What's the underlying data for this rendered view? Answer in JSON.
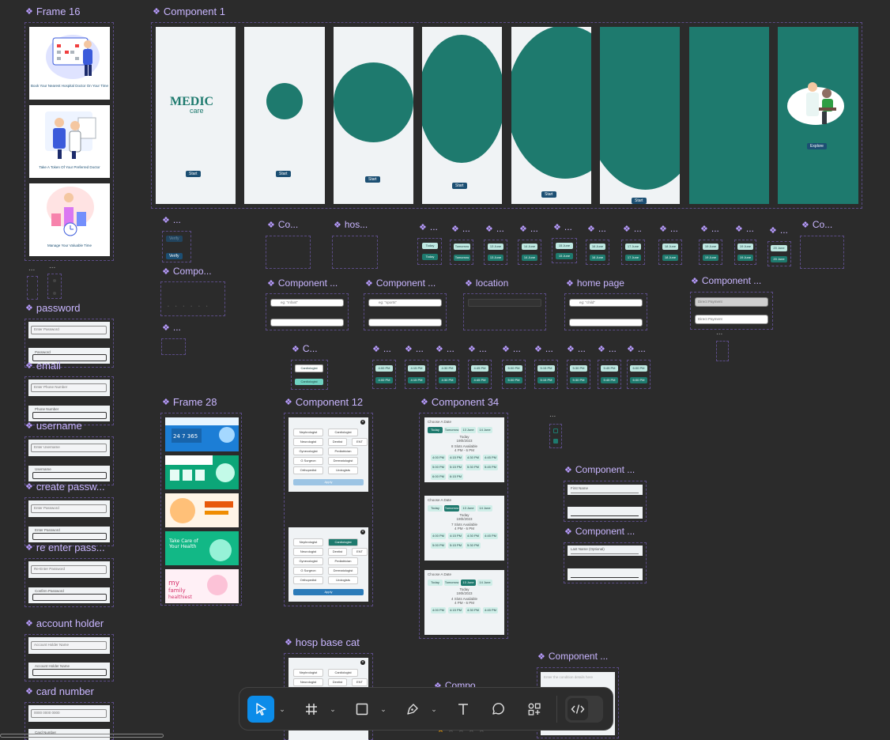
{
  "frames": {
    "frame16": "Frame 16",
    "component1": "Component 1",
    "password": "password",
    "email": "email",
    "username": "username",
    "create_password": "create passw...",
    "reenter_password": "re enter pass...",
    "account_holder": "account holder",
    "card_number": "card number",
    "frame28": "Frame 28",
    "component12": "Component 12",
    "component34": "Component 34",
    "hosp_base_cat": "hosp base cat",
    "location": "location",
    "home_page": "home page",
    "component_trunc": "Component ...",
    "compo": "Compo...",
    "compo2": "Compo",
    "co": "Co...",
    "hos": "hos...",
    "c": "C...",
    "ellipsis": "..."
  },
  "onboarding": {
    "slide1_text": "Book Your Nearest Hospital Doctor On Your Time",
    "slide2_text": "Take A Token Of Your Preferred Doctor",
    "slide3_text": "Manage Your Valuable Time",
    "brand_main": "MEDIC",
    "brand_sub": "care",
    "start": "Start",
    "explore": "Explore"
  },
  "forms": {
    "enter_password": "Enter Password",
    "password_label": "Password",
    "enter_phone": "Enter Phone Number",
    "phone_label": "Phone Number",
    "enter_username": "Enter Username",
    "username_label": "Username",
    "enter_password2": "Enter Password",
    "password_label2": "Enter Password",
    "reenter": "Re-Enter Password",
    "confirm": "Confirm Password",
    "account_holder_name": "Account Holder Name",
    "card_placeholder": "0000 0000 0000",
    "card_label": "Card Number",
    "first_name": "First Name",
    "last_name": "Last Name (Optional)",
    "verify": "Verify",
    "search_hint1": "eg: \"Infant\"",
    "search_hint2": "eg: \"sports\"",
    "search_hint3": "eg: \"child\"",
    "notes_hint": "Enter the condition details here"
  },
  "payment": {
    "direct": "Direct Payment",
    "direct2": "Direct Payment"
  },
  "categories": {
    "items": [
      "Nephrologist",
      "Cardiologist",
      "Neurologist",
      "Dentist",
      "ENT",
      "Gynecologist",
      "Pediatrician",
      "G Surgeon",
      "Dermatologist",
      "Orthopedist",
      "Urologists"
    ],
    "apply": "Apply",
    "cardiologist": "Cardiologist"
  },
  "schedule": {
    "choose_date": "Choose A Date",
    "today": "Today",
    "tomorrow": "Tomorrow",
    "d13": "13 June",
    "d14": "14 June",
    "d15": "15 June",
    "d16": "16 June",
    "d17": "17 June",
    "d18": "18 June",
    "d19": "19 June",
    "d20": "20 June",
    "d12": "12 June",
    "date_label": "19th/2023",
    "slots8": "8 Slots Available",
    "slots7": "7 Slots Available",
    "slots4": "4 Slots Available",
    "range": "4 PM - 6 PM",
    "t1": "4:00 PM",
    "t2": "4:15 PM",
    "t3": "4:30 PM",
    "t4": "4:45 PM",
    "t5": "5:00 PM",
    "t6": "5:15 PM",
    "t7": "5:30 PM",
    "t8": "6:00 PM",
    "t9": "5:45 PM",
    "t10": "6:15 PM"
  },
  "toolbar": {
    "move": "move-tool",
    "frame": "frame-tool",
    "shape": "rectangle-tool",
    "pen": "pen-tool",
    "text": "text-tool",
    "comment": "comment-tool",
    "actions": "actions-tool",
    "dev": "dev-mode-toggle",
    "accent": "#0c8ce9"
  }
}
